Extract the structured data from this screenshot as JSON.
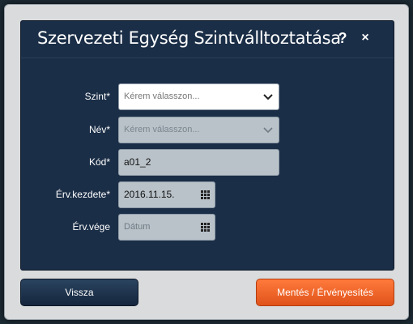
{
  "dialog": {
    "title": "Szervezeti Egység Szintválltoztatása",
    "help_label": "?",
    "close_label": "×"
  },
  "form": {
    "level": {
      "label": "Szint*",
      "placeholder": "Kérem válasszon..."
    },
    "name": {
      "label": "Név*",
      "placeholder": "Kérem válasszon..."
    },
    "code": {
      "label": "Kód*",
      "value": "a01_2"
    },
    "valid_from": {
      "label": "Érv.kezdete*",
      "value": "2016.11.15."
    },
    "valid_to": {
      "label": "Érv.vége",
      "placeholder": "Dátum"
    }
  },
  "buttons": {
    "back_label": "Vissza",
    "save_label": "Mentés / Érvényesítés"
  },
  "colors": {
    "panel_bg": "#1b2e47",
    "save_accent": "#f06a2e",
    "dialog_bg": "#d9dbdc"
  },
  "icons": {
    "dropdown": "chevron-down-icon",
    "date": "calendar-icon"
  }
}
